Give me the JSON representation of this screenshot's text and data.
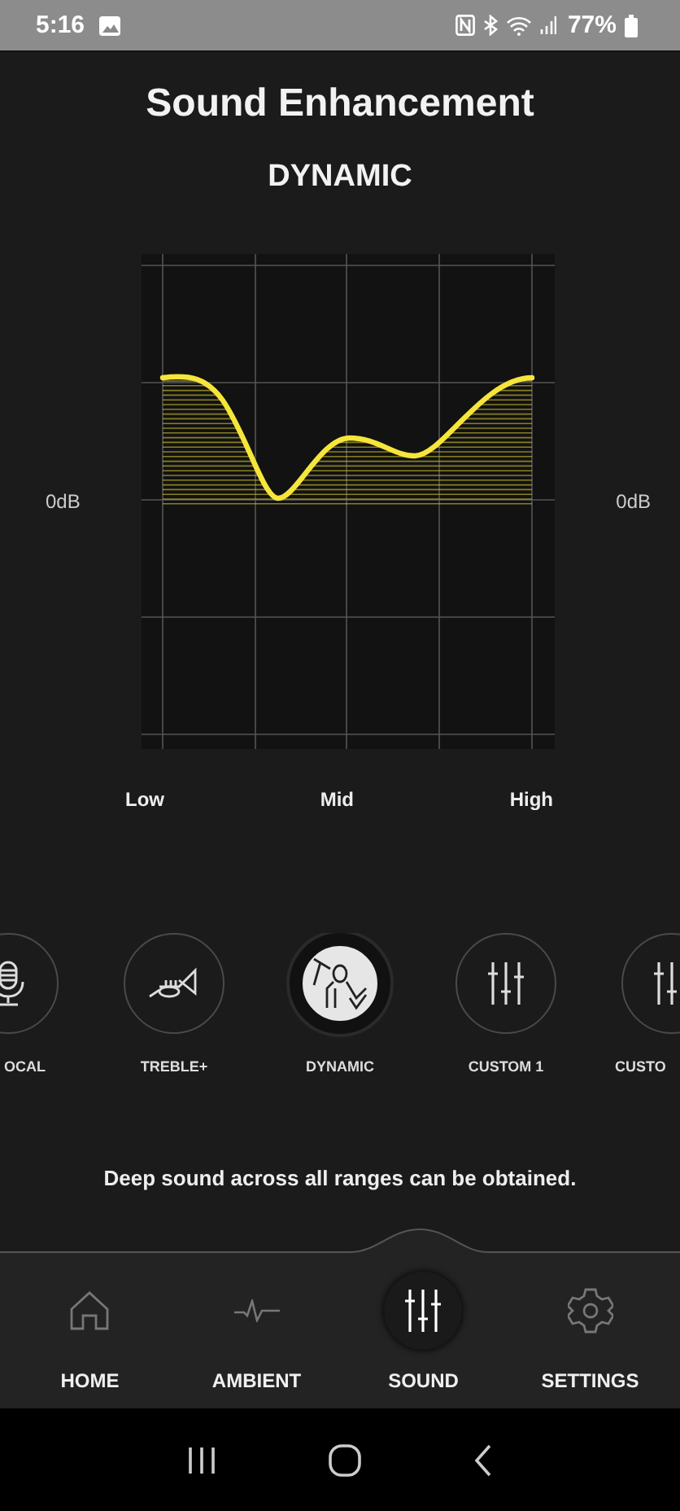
{
  "status_bar": {
    "time": "5:16",
    "battery": "77%"
  },
  "title": "Sound Enhancement",
  "subtitle": "DYNAMIC",
  "graph": {
    "left_label": "0dB",
    "right_label": "0dB",
    "x_labels": [
      "Low",
      "Mid",
      "High"
    ]
  },
  "presets": [
    {
      "label": "OCAL",
      "kind": "mic",
      "selected": false
    },
    {
      "label": "TREBLE+",
      "kind": "trumpet",
      "selected": false
    },
    {
      "label": "DYNAMIC",
      "kind": "conductor",
      "selected": true
    },
    {
      "label": "CUSTOM 1",
      "kind": "sliders",
      "selected": false
    },
    {
      "label": "CUSTO",
      "kind": "sliders",
      "selected": false
    }
  ],
  "description": "Deep sound across all ranges can be obtained.",
  "nav": [
    {
      "label": "HOME",
      "kind": "home",
      "selected": false
    },
    {
      "label": "AMBIENT",
      "kind": "pulse",
      "selected": false
    },
    {
      "label": "SOUND",
      "kind": "sliders",
      "selected": true
    },
    {
      "label": "SETTINGS",
      "kind": "gear",
      "selected": false
    }
  ]
}
